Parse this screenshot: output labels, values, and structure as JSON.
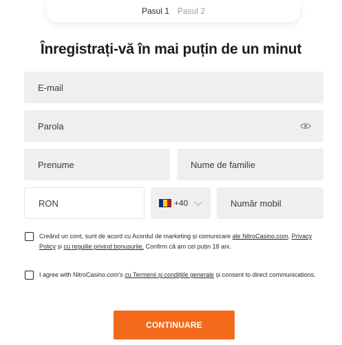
{
  "steps": {
    "step1": "Pasul 1",
    "step2": "Pasul 2"
  },
  "title": "Înregistrați-vă în mai puțin de un minut",
  "fields": {
    "email": "E-mail",
    "password": "Parola",
    "first_name": "Prenume",
    "last_name": "Nume de familie",
    "currency": "RON",
    "country_code": "+40",
    "mobile": "Număr mobil"
  },
  "icons": {
    "password_toggle": "eye-icon",
    "dropdown": "chevron-down-icon",
    "flag": "romania-flag-icon"
  },
  "flag_colors": [
    "#002b7f",
    "#fcd116",
    "#ce1126"
  ],
  "consent1": {
    "text_a": "Creând un cont, sunt de acord cu Acordul de marketing și comunicare ",
    "link_a": "ale NitroCasino.com",
    "text_b": ", ",
    "link_b": "Privacy Policy",
    "text_c": " și ",
    "link_c": "cu regulile privind bonusurile.",
    "text_d": " Confirm că am cel puțin 18 ani."
  },
  "consent2": {
    "text_a": "I agree with NitroCasino.com's ",
    "link_a": "cu Termenii și condițiile generale",
    "text_b": " și consent to direct communications."
  },
  "cta_label": "CONTINUARE",
  "accent_color": "#f36a1b"
}
